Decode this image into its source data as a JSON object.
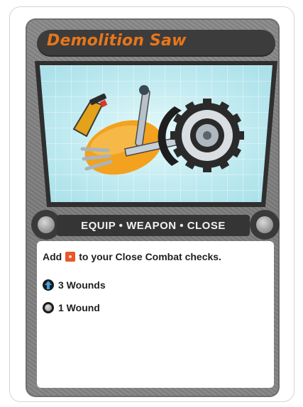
{
  "card": {
    "title": "Demolition Saw",
    "keywords": "EQUIP • WEAPON • CLOSE",
    "rule": {
      "prefix": "Add",
      "suffix": "to your Close Combat checks.",
      "die_icon": "red-die-icon"
    },
    "stats": [
      {
        "icon": "blue-wound-arrow-icon",
        "text": "3 Wounds"
      },
      {
        "icon": "gray-wound-circle-icon",
        "text": "1 Wound"
      }
    ]
  },
  "colors": {
    "title": "#e8761a",
    "frame": "#808080",
    "die": "#e8572a",
    "wound_blue": "#1c6fa8"
  }
}
